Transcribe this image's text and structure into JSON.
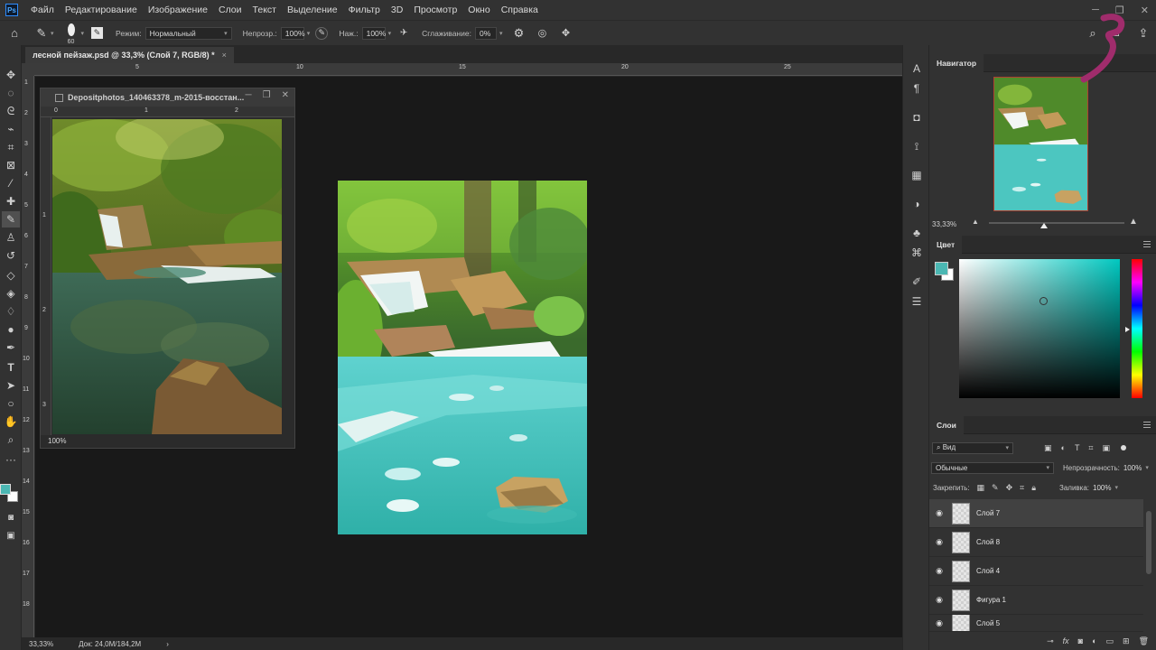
{
  "app": {
    "logo_text": "Ps"
  },
  "menu": [
    "Файл",
    "Редактирование",
    "Изображение",
    "Слои",
    "Текст",
    "Выделение",
    "Фильтр",
    "3D",
    "Просмотр",
    "Окно",
    "Справка"
  ],
  "window_controls": {
    "minimize": "─",
    "restore": "❐",
    "close": "✕"
  },
  "options": {
    "brush_size": "60",
    "mode_label": "Режим:",
    "mode_value": "Нормальный",
    "opacity_label": "Непрозр.:",
    "opacity_value": "100%",
    "pressure_label": "Наж.:",
    "pressure_value": "100%",
    "smoothing_label": "Сглаживание:",
    "smoothing_value": "0%"
  },
  "document": {
    "tab_title": "лесной пейзаж.psd @ 33,3% (Слой 7, RGB/8) *",
    "tab_close": "×",
    "zoom": "33,33%",
    "doc_info": "Док: 24,0M/184,2M",
    "status_arrow": "›",
    "ruler_h_marks": [
      "5",
      "10",
      "15",
      "20",
      "25"
    ],
    "ruler_v_marks": [
      "1",
      "2",
      "3",
      "4",
      "5",
      "6",
      "7",
      "8",
      "9",
      "10",
      "11",
      "12",
      "13",
      "14",
      "15",
      "16",
      "17",
      "18"
    ]
  },
  "reference_window": {
    "title": "Depositphotos_140463378_m-2015-восстан...",
    "zoom": "100%",
    "ruler_h_marks": [
      "0",
      "1",
      "2"
    ],
    "ruler_v_marks": [
      "1",
      "2",
      "3"
    ]
  },
  "navigator": {
    "tab": "Навигатор",
    "zoom": "33,33%"
  },
  "color_panel": {
    "tab": "Цвет",
    "foreground": "#4bb7b3",
    "background": "#ffffff"
  },
  "layers": {
    "tab": "Слои",
    "filter_label": "Вид",
    "blend_mode": "Обычные",
    "opacity_label": "Непрозрачность:",
    "opacity_value": "100%",
    "lock_label": "Закрепить:",
    "fill_label": "Заливка:",
    "fill_value": "100%",
    "items": [
      {
        "name": "Слой 7",
        "selected": true
      },
      {
        "name": "Слой 8",
        "selected": false
      },
      {
        "name": "Слой 4",
        "selected": false
      },
      {
        "name": "Фигура 1",
        "selected": false
      },
      {
        "name": "Слой 5",
        "selected": false
      }
    ],
    "bottom_icons": [
      "link-icon",
      "fx-icon",
      "mask-icon",
      "adjustment-icon",
      "group-icon",
      "new-layer-icon",
      "trash-icon"
    ]
  },
  "tools": [
    "move",
    "marquee",
    "lasso",
    "quick-select",
    "crop",
    "frame",
    "eyedropper",
    "healing",
    "brush",
    "stamp",
    "history-brush",
    "eraser",
    "fill",
    "blur",
    "dodge",
    "pen",
    "text",
    "path-select",
    "shape",
    "hand",
    "zoom",
    "more"
  ],
  "right_column_icons": [
    "character-icon",
    "paragraph-icon",
    "learn-icon",
    "clone-source-icon",
    "swatches-icon",
    "color-icon",
    "shapes-icon",
    "paths-icon",
    "brushes-icon",
    "adjustments-icon"
  ]
}
